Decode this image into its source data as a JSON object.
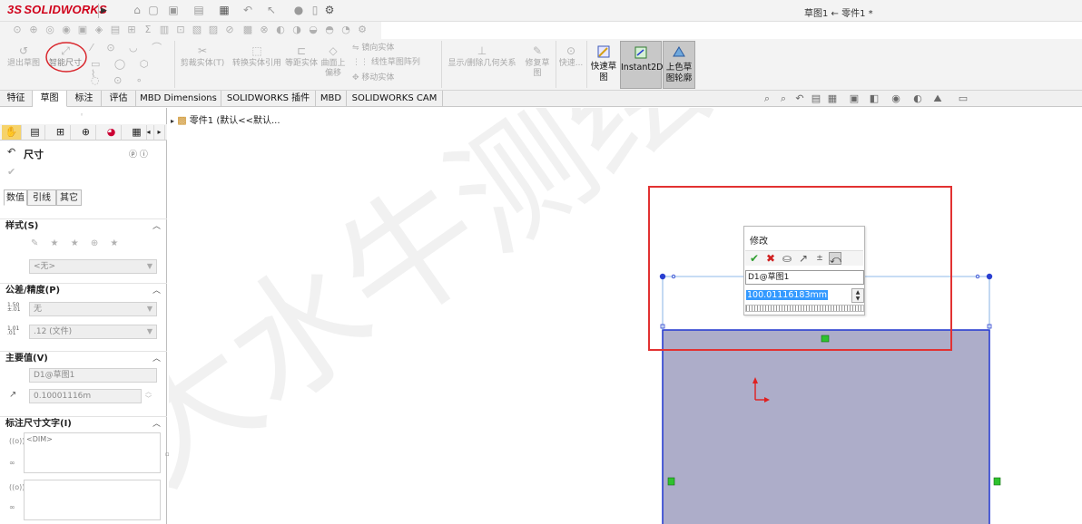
{
  "app": {
    "brand": "SOLIDWORKS",
    "brand_prefix": "3S",
    "document_title": "草图1 ← 零件1 *"
  },
  "command_manager": {
    "exit_sketch": "退出草图",
    "smart_dimension": "智能尺寸",
    "trim_entities": "剪裁实体(T)",
    "convert_entities": "转换实体引用",
    "offset_entities": "等距实体",
    "offset_on_surface_line1": "曲面上",
    "offset_on_surface_line2": "偏移",
    "mirror_entities": "镜向实体",
    "linear_pattern": "线性草图阵列",
    "move_entities": "移动实体",
    "display_relations": "显示/删除几何关系",
    "repair_sketch_line1": "修复草",
    "repair_sketch_line2": "图",
    "quick_snaps": "快速...",
    "rapid_sketch_line1": "快速草",
    "rapid_sketch_line2": "图",
    "instant2d": "Instant2D",
    "shaded_sketch_line1": "上色草",
    "shaded_sketch_line2": "图轮廓"
  },
  "tabs": [
    {
      "label": "特征"
    },
    {
      "label": "草图"
    },
    {
      "label": "标注"
    },
    {
      "label": "评估"
    },
    {
      "label": "MBD Dimensions"
    },
    {
      "label": "SOLIDWORKS 插件"
    },
    {
      "label": "MBD"
    },
    {
      "label": "SOLIDWORKS CAM"
    }
  ],
  "property_manager": {
    "title": "尺寸",
    "help_icons": "? ?",
    "sub_tabs": [
      {
        "label": "数值"
      },
      {
        "label": "引线"
      },
      {
        "label": "其它"
      }
    ],
    "style_section": "样式(S)",
    "style_value": "<无>",
    "tolerance_section": "公差/精度(P)",
    "tolerance_type": "无",
    "precision_value": ".12 (文件)",
    "primary_value_section": "主要值(V)",
    "primary_name": "D1@草图1",
    "primary_value": "0.10001116m",
    "dimension_text_section": "标注尺寸文字(I)",
    "dim_text_value": "<DIM>"
  },
  "feature_tree": {
    "root_label": "零件1 (默认<<默认..."
  },
  "modify_dialog": {
    "title": "修改",
    "dimension_name": "D1@草图1",
    "value": "100.01116183mm"
  },
  "watermark": "大水牛测绘",
  "colors": {
    "sketch_line": "#2a3fd1",
    "sketch_fill": "#adadc9",
    "highlight_rect": "#e23232",
    "ok_green": "#2f9e2f",
    "cancel_red": "#d02020",
    "brand_red": "#d0021b"
  }
}
